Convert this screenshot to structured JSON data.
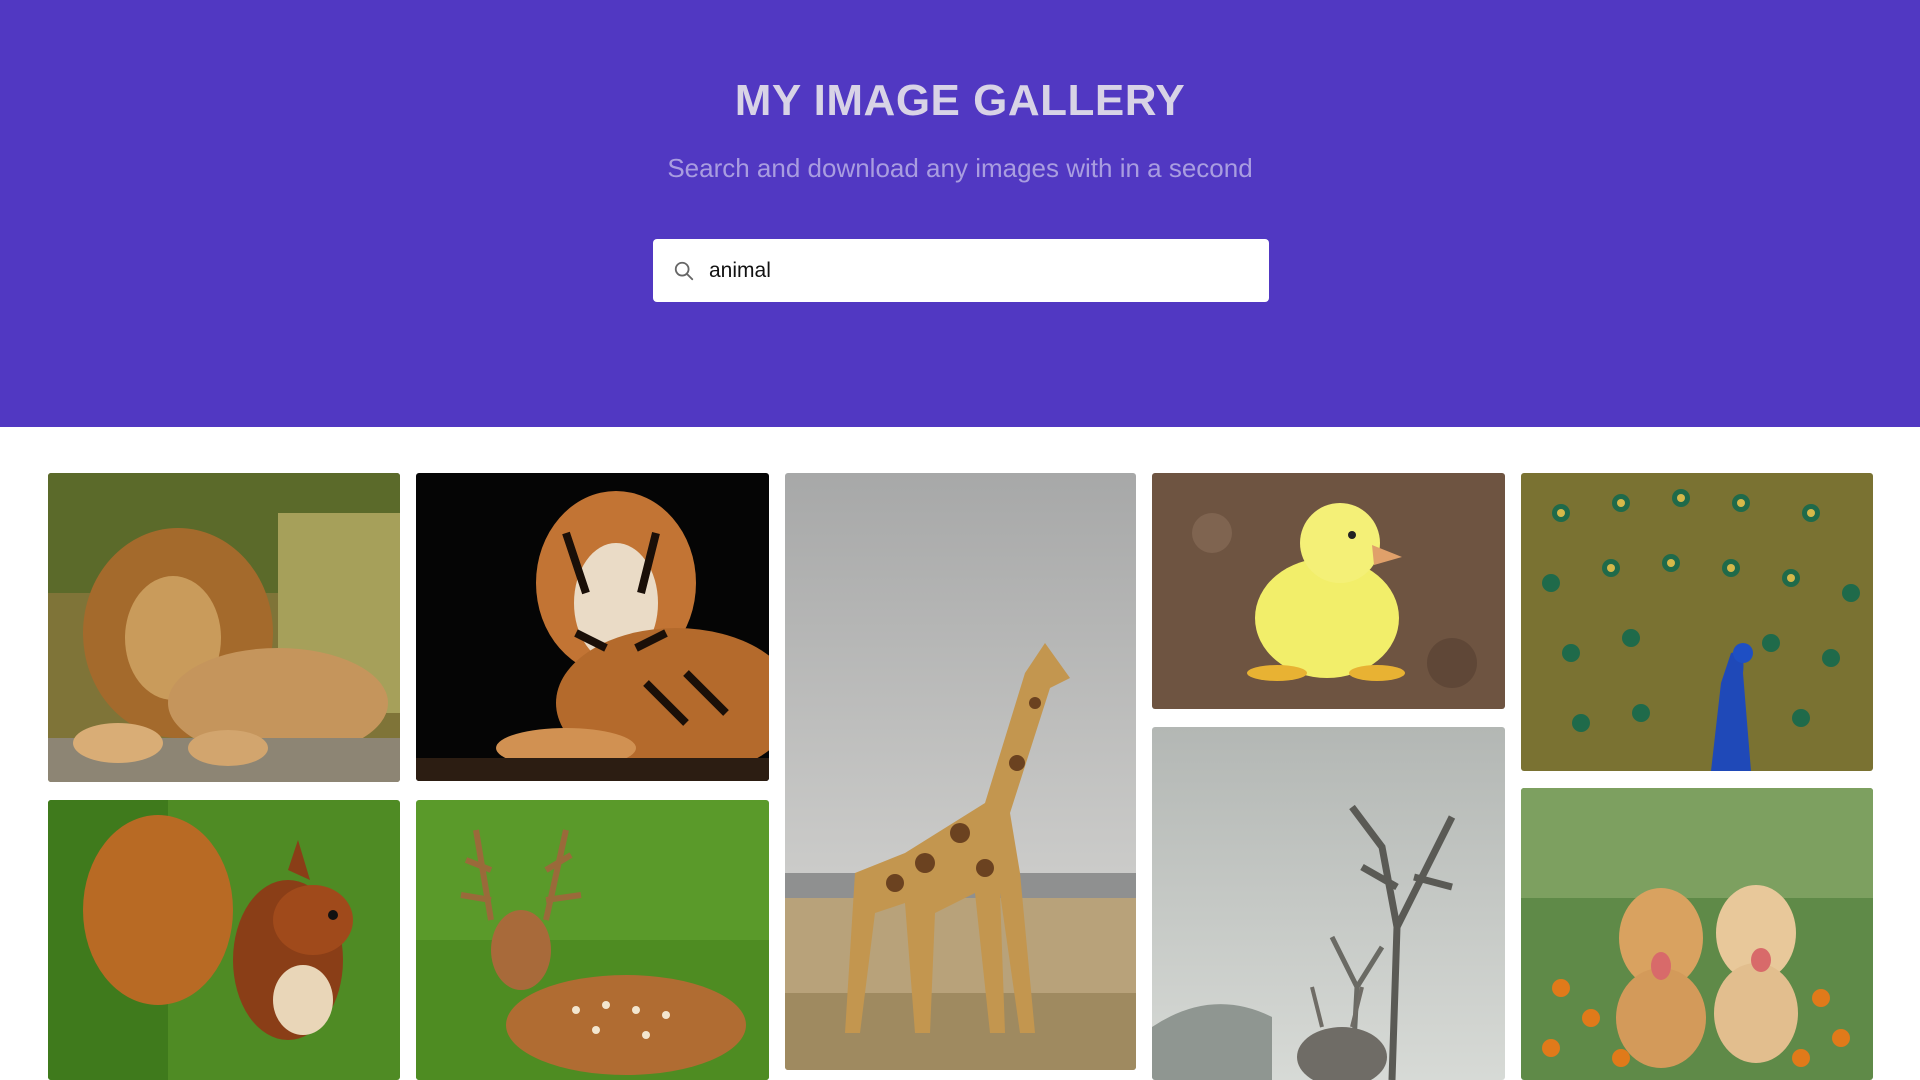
{
  "header": {
    "title": "MY IMAGE GALLERY",
    "subtitle": "Search and download any images with in a second"
  },
  "search": {
    "value": "animal",
    "icon": "search-icon"
  },
  "gallery": {
    "images": [
      {
        "subject": "lion"
      },
      {
        "subject": "tiger"
      },
      {
        "subject": "giraffe"
      },
      {
        "subject": "duckling"
      },
      {
        "subject": "peacock"
      },
      {
        "subject": "squirrel"
      },
      {
        "subject": "deer"
      },
      {
        "subject": "stag by tree"
      },
      {
        "subject": "puppies"
      }
    ]
  },
  "colors": {
    "header_bg": "#5138c2",
    "title": "#d8d3e6",
    "subtitle": "#a99de0"
  }
}
